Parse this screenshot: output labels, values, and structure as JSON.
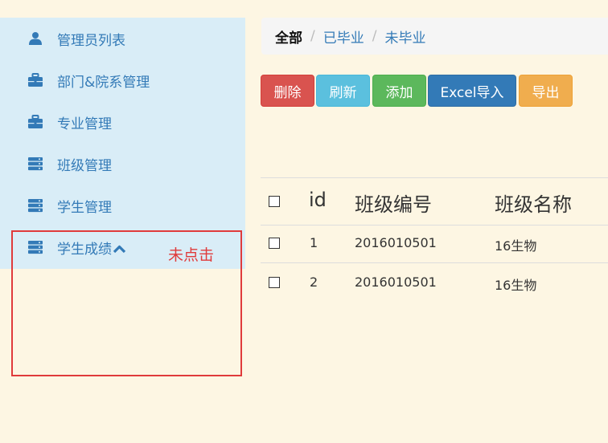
{
  "sidebar": {
    "items": [
      {
        "label": "管理员列表",
        "icon": "user-icon"
      },
      {
        "label": "部门&院系管理",
        "icon": "briefcase-icon"
      },
      {
        "label": "专业管理",
        "icon": "briefcase-icon"
      },
      {
        "label": "班级管理",
        "icon": "server-icon"
      },
      {
        "label": "学生管理",
        "icon": "server-icon"
      },
      {
        "label": "学生成绩",
        "icon": "server-icon",
        "caret": "chevron-up-icon"
      }
    ]
  },
  "annotation": {
    "text": "未点击",
    "color": "#e03b3b"
  },
  "breadcrumb": {
    "active": "全部",
    "links": [
      "已毕业",
      "未毕业"
    ],
    "separator": "/"
  },
  "toolbar": {
    "delete_label": "删除",
    "refresh_label": "刷新",
    "add_label": "添加",
    "excel_import_label": "Excel导入",
    "export_label": "导出"
  },
  "table": {
    "headers": [
      "id",
      "班级编号",
      "班级名称"
    ],
    "rows": [
      {
        "id": "1",
        "class_code": "2016010501",
        "class_name": "16生物",
        "checked": false
      },
      {
        "id": "2",
        "class_code": "2016010501",
        "class_name": "16生物",
        "checked": false
      }
    ]
  },
  "colors": {
    "sidebar_bg": "#d9edf7",
    "link": "#337ab7",
    "page_bg": "#fdf6e3",
    "danger": "#d9534f",
    "info": "#5bc0de",
    "success": "#5cb85c",
    "primary": "#337ab7",
    "warning": "#f0ad4e"
  }
}
